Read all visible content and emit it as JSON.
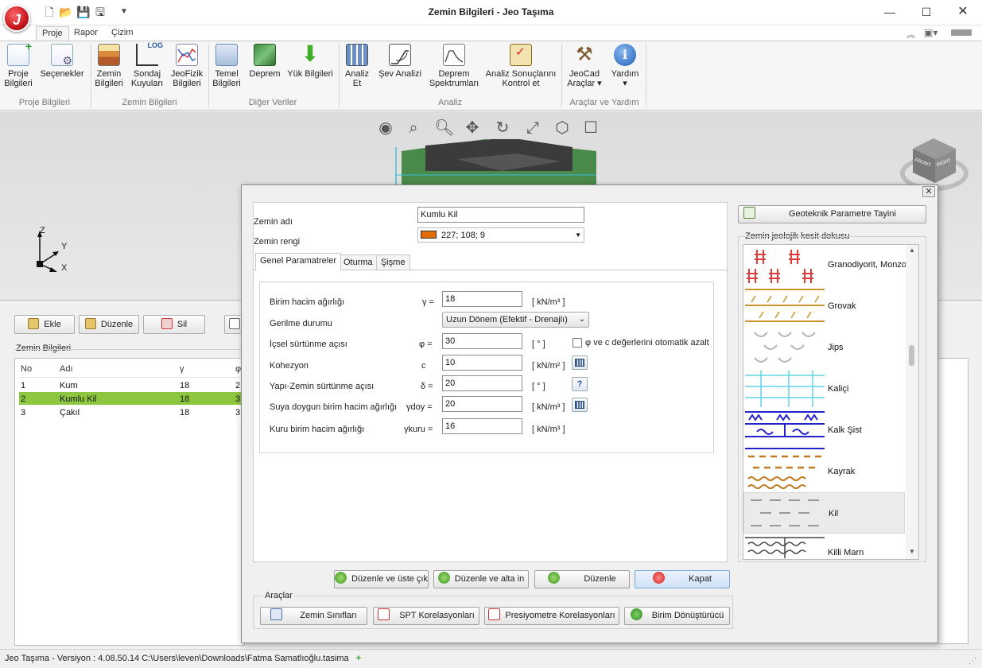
{
  "window": {
    "title": "Zemin Bilgileri - Jeo Taşıma",
    "logo_letter": "J"
  },
  "ribbon": {
    "tabs": [
      "Proje",
      "Rapor",
      "Çizim"
    ],
    "groups": [
      {
        "label": "Proje Bilgileri",
        "buttons": [
          "Proje\nBilgileri",
          "Seçenekler"
        ]
      },
      {
        "label": "Zemin Bilgileri",
        "buttons": [
          "Zemin\nBilgileri",
          "Sondaj\nKuyuları",
          "JeoFizik\nBilgileri"
        ]
      },
      {
        "label": "Diğer Veriler",
        "buttons": [
          "Temel\nBilgileri",
          "Deprem",
          "Yük Bilgileri"
        ]
      },
      {
        "label": "Analiz",
        "buttons": [
          "Analiz\nEt",
          "Şev Analizi",
          "Deprem\nSpektrumları",
          "Analiz Sonuçlarını\nKontrol et"
        ]
      },
      {
        "label": "Araçlar ve Yardım",
        "buttons": [
          "JeoCad\nAraçlar ▾",
          "Yardım\n▾"
        ]
      }
    ],
    "log_badge": "LOG"
  },
  "viewport": {
    "axis_labels": {
      "z": "Z",
      "y": "Y",
      "x": "X"
    },
    "cube_labels": {
      "front": "FRONT",
      "right": "RIGHT"
    }
  },
  "left": {
    "buttons": {
      "add": "Ekle",
      "edit": "Düzenle",
      "delete": "Sil"
    },
    "group_title": "Zemin Bilgileri",
    "columns": [
      "No",
      "Adı",
      "γ",
      "φ"
    ],
    "rows": [
      {
        "no": "1",
        "name": "Kum",
        "gamma": "18",
        "phi": "2"
      },
      {
        "no": "2",
        "name": "Kumlu Kil",
        "gamma": "18",
        "phi": "3"
      },
      {
        "no": "3",
        "name": "Çakıl",
        "gamma": "18",
        "phi": "3"
      }
    ]
  },
  "status": {
    "text": "Jeo Taşıma - Versiyon : 4.08.50.14  C:\\Users\\leven\\Downloads\\Fatma Samatlıoğlu.tasima"
  },
  "dialog": {
    "soil_name_label": "Zemin adı",
    "soil_name_value": "Kumlu Kil",
    "soil_color_label": "Zemin rengi",
    "soil_color_value": "227; 108; 9",
    "soil_color_hex": "#e36c09",
    "tabs": [
      "Genel Paramatreler",
      "Oturma",
      "Şişme"
    ],
    "params": [
      {
        "label": "Birim hacim ağırlığı",
        "symbol": "γ =",
        "value": "18",
        "unit": "[ kN/m³ ]"
      },
      {
        "label": "Gerilme durumu",
        "symbol": "",
        "value": "Uzun Dönem (Efektif - Drenajlı)",
        "unit": ""
      },
      {
        "label": "İçsel sürtünme açısı",
        "symbol": "φ =",
        "value": "30",
        "unit": "[ ° ]"
      },
      {
        "label": "Kohezyon",
        "symbol": "c",
        "value": "10",
        "unit": "[ kN/m² ]"
      },
      {
        "label": "Yapı-Zemin sürtünme açısı",
        "symbol": "δ =",
        "value": "20",
        "unit": "[ ° ]"
      },
      {
        "label": "Suya doygun birim hacim ağırlığı",
        "symbol": "γdoy =",
        "value": "20",
        "unit": "[ kN/m³ ]"
      },
      {
        "label": "Kuru birim hacim ağırlığı",
        "symbol": "γkuru =",
        "value": "16",
        "unit": "[ kN/m³ ]"
      }
    ],
    "auto_reduce_label": "φ ve c değerlerini otomatik azalt",
    "geo_param_button": "Geoteknik Parametre Tayini",
    "texture_group_title": "Zemin jeolojik kesit dokusu",
    "textures": [
      "Granodiyorit, Monzo",
      "Grovak",
      "Jips",
      "Kaliçi",
      "Kalk Şist",
      "Kayrak",
      "Kil",
      "Killi Marn"
    ],
    "action_buttons": {
      "save_up": "Düzenle ve üste çık",
      "save_down": "Düzenle ve alta in",
      "save": "Düzenle",
      "close": "Kapat"
    },
    "tools_title": "Araçlar",
    "tool_buttons": [
      "Zemin Sınıfları",
      "SPT Korelasyonları",
      "Presiyometre Korelasyonları",
      "Birim Dönüştürücü"
    ]
  }
}
